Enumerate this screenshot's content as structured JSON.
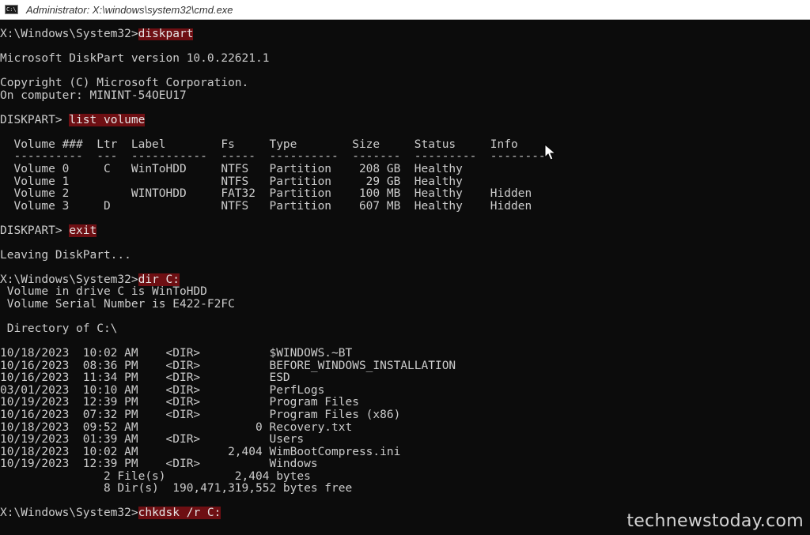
{
  "window": {
    "title": "Administrator: X:\\windows\\system32\\cmd.exe",
    "app_icon_glyph": "C:\\"
  },
  "console": {
    "lines": [
      {
        "prompt": "X:\\Windows\\System32>",
        "cmd": "diskpart"
      },
      {
        "text": ""
      },
      {
        "text": "Microsoft DiskPart version 10.0.22621.1"
      },
      {
        "text": ""
      },
      {
        "text": "Copyright (C) Microsoft Corporation."
      },
      {
        "text": "On computer: MININT-54OEU17"
      },
      {
        "text": ""
      },
      {
        "prompt": "DISKPART> ",
        "cmd": "list volume"
      },
      {
        "text": ""
      },
      {
        "text": "  Volume ###  Ltr  Label        Fs     Type        Size     Status     Info"
      },
      {
        "text": "  ----------  ---  -----------  -----  ----------  -------  ---------  --------"
      },
      {
        "text": "  Volume 0     C   WinToHDD     NTFS   Partition    208 GB  Healthy"
      },
      {
        "text": "  Volume 1                      NTFS   Partition     29 GB  Healthy"
      },
      {
        "text": "  Volume 2         WINTOHDD     FAT32  Partition    100 MB  Healthy    Hidden"
      },
      {
        "text": "  Volume 3     D                NTFS   Partition    607 MB  Healthy    Hidden"
      },
      {
        "text": ""
      },
      {
        "prompt": "DISKPART> ",
        "cmd": "exit"
      },
      {
        "text": ""
      },
      {
        "text": "Leaving DiskPart..."
      },
      {
        "text": ""
      },
      {
        "prompt": "X:\\Windows\\System32>",
        "cmd": "dir C:"
      },
      {
        "text": " Volume in drive C is WinToHDD"
      },
      {
        "text": " Volume Serial Number is E422-F2FC"
      },
      {
        "text": ""
      },
      {
        "text": " Directory of C:\\"
      },
      {
        "text": ""
      },
      {
        "text": "10/18/2023  10:02 AM    <DIR>          $WINDOWS.~BT"
      },
      {
        "text": "10/16/2023  08:36 PM    <DIR>          BEFORE_WINDOWS_INSTALLATION"
      },
      {
        "text": "10/16/2023  11:34 PM    <DIR>          ESD"
      },
      {
        "text": "03/01/2023  10:10 AM    <DIR>          PerfLogs"
      },
      {
        "text": "10/19/2023  12:39 PM    <DIR>          Program Files"
      },
      {
        "text": "10/16/2023  07:32 PM    <DIR>          Program Files (x86)"
      },
      {
        "text": "10/18/2023  09:52 AM                 0 Recovery.txt"
      },
      {
        "text": "10/19/2023  01:39 AM    <DIR>          Users"
      },
      {
        "text": "10/18/2023  10:02 AM             2,404 WimBootCompress.ini"
      },
      {
        "text": "10/19/2023  12:39 PM    <DIR>          Windows"
      },
      {
        "text": "               2 File(s)          2,404 bytes"
      },
      {
        "text": "               8 Dir(s)  190,471,319,552 bytes free"
      },
      {
        "text": ""
      },
      {
        "prompt": "X:\\Windows\\System32>",
        "cmd": "chkdsk /r C:"
      }
    ]
  },
  "watermark": "technewstoday.com",
  "colors": {
    "background": "#0c0c0c",
    "text": "#cccccc",
    "command_highlight": "#6e0f13"
  },
  "icons": {
    "app": "cmd-console-icon",
    "cursor": "mouse-pointer-icon"
  }
}
